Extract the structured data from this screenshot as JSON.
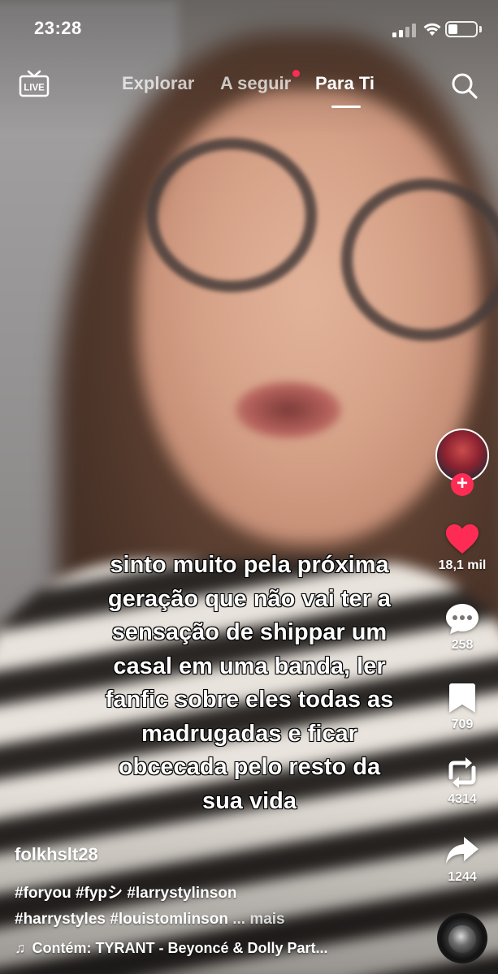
{
  "status_bar": {
    "time": "23:28",
    "battery_level": 0.35
  },
  "top_nav": {
    "live_label": "LIVE",
    "tabs": [
      {
        "label": "Explorar",
        "active": false
      },
      {
        "label": "A seguir",
        "active": false,
        "has_notification_dot": true
      },
      {
        "label": "Para Ti",
        "active": true
      }
    ],
    "search_icon": "search-icon"
  },
  "video": {
    "caption_lines": [
      "sinto muito pela próxima",
      "geração que não vai ter a",
      "sensação de shippar um",
      "casal em uma banda, ler",
      "fanfic sobre eles todas as",
      "madrugadas e ficar",
      "obcecada pelo resto da",
      "sua vida"
    ]
  },
  "right_rail": {
    "follow_symbol": "+",
    "likes": "18,1 mil",
    "comments": "258",
    "bookmarks": "709",
    "reposts": "4314",
    "shares": "1244",
    "colors": {
      "like": "#fe2c55",
      "follow": "#fe2c55"
    }
  },
  "post": {
    "username": "folkhslt28",
    "description_line1": "#foryou #fypシ #larrystylinson",
    "description_line2": "#harrystyles #louistomlinson",
    "more_label": "... mais",
    "music": "Contém: TYRANT - Beyoncé & Dolly Part..."
  }
}
